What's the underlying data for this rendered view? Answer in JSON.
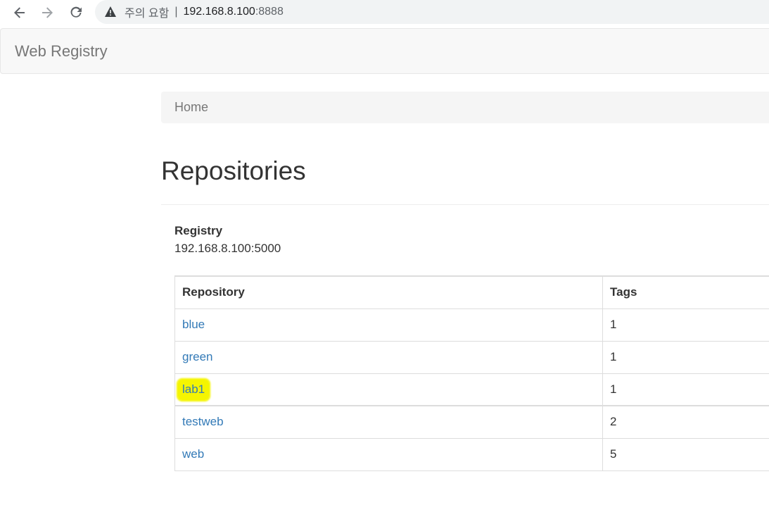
{
  "browser": {
    "security_label": "주의 요함",
    "separator": "|",
    "url_host": "192.168.8.100",
    "url_port": ":8888"
  },
  "navbar": {
    "brand": "Web Registry"
  },
  "breadcrumb": {
    "home": "Home"
  },
  "page": {
    "title": "Repositories"
  },
  "registry": {
    "label": "Registry",
    "address": "192.168.8.100:5000"
  },
  "table": {
    "headers": [
      "Repository",
      "Tags"
    ],
    "rows": [
      {
        "repository": "blue",
        "tags": "1"
      },
      {
        "repository": "green",
        "tags": "1"
      },
      {
        "repository": "lab1",
        "tags": "1"
      },
      {
        "repository": "testweb",
        "tags": "2"
      },
      {
        "repository": "web",
        "tags": "5"
      }
    ]
  },
  "colors": {
    "link": "#337ab7",
    "highlight": "#f5f500"
  }
}
